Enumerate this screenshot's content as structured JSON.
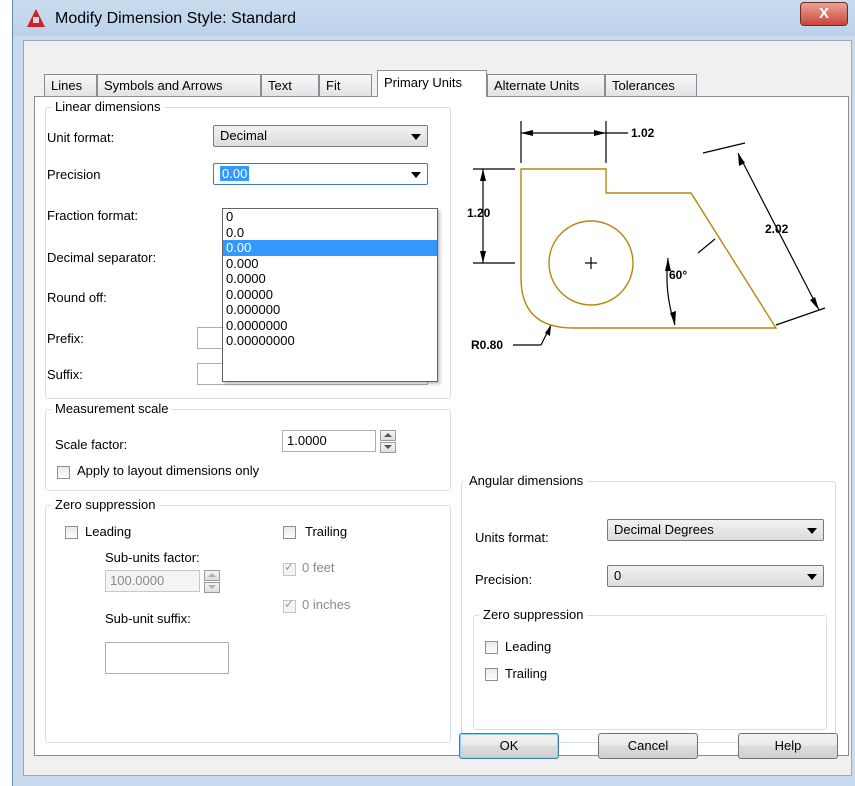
{
  "window": {
    "title": "Modify Dimension Style: Standard",
    "close_glyph": "X"
  },
  "tabs": [
    {
      "label": "Lines"
    },
    {
      "label": "Symbols and Arrows"
    },
    {
      "label": "Text"
    },
    {
      "label": "Fit"
    },
    {
      "label": "Primary Units"
    },
    {
      "label": "Alternate Units"
    },
    {
      "label": "Tolerances"
    }
  ],
  "active_tab": "Primary Units",
  "linear": {
    "group_title": "Linear dimensions",
    "unit_format_label": "Unit format:",
    "unit_format_value": "Decimal",
    "precision_label": "Precision",
    "precision_value": "0.00",
    "fraction_format_label": "Fraction format:",
    "decimal_separator_label": "Decimal separator:",
    "round_off_label": "Round off:",
    "prefix_label": "Prefix:",
    "suffix_label": "Suffix:",
    "precision_options": [
      "0",
      "0.0",
      "0.00",
      "0.000",
      "0.0000",
      "0.00000",
      "0.000000",
      "0.0000000",
      "0.00000000"
    ],
    "precision_selected_index": 2
  },
  "measurement": {
    "group_title": "Measurement scale",
    "scale_factor_label": "Scale factor:",
    "scale_factor_value": "1.0000",
    "apply_layout_label": "Apply to layout dimensions only",
    "apply_layout_checked": false
  },
  "zero_suppression": {
    "group_title": "Zero suppression",
    "leading_label": "Leading",
    "trailing_label": "Trailing",
    "sub_units_factor_label": "Sub-units factor:",
    "sub_units_factor_value": "100.0000",
    "zero_feet_label": "0 feet",
    "zero_inches_label": "0 inches",
    "sub_unit_suffix_label": "Sub-unit suffix:"
  },
  "preview": {
    "dim_top": "1.02",
    "dim_left": "1.20",
    "dim_right": "2.02",
    "dim_angle": "60°",
    "dim_radius": "R0.80",
    "line_color": "#b8860b"
  },
  "angular": {
    "group_title": "Angular dimensions",
    "units_format_label": "Units format:",
    "units_format_value": "Decimal Degrees",
    "precision_label": "Precision:",
    "precision_value": "0",
    "zero_group_title": "Zero suppression",
    "leading_label": "Leading",
    "trailing_label": "Trailing"
  },
  "buttons": {
    "ok": "OK",
    "cancel": "Cancel",
    "help": "Help"
  }
}
